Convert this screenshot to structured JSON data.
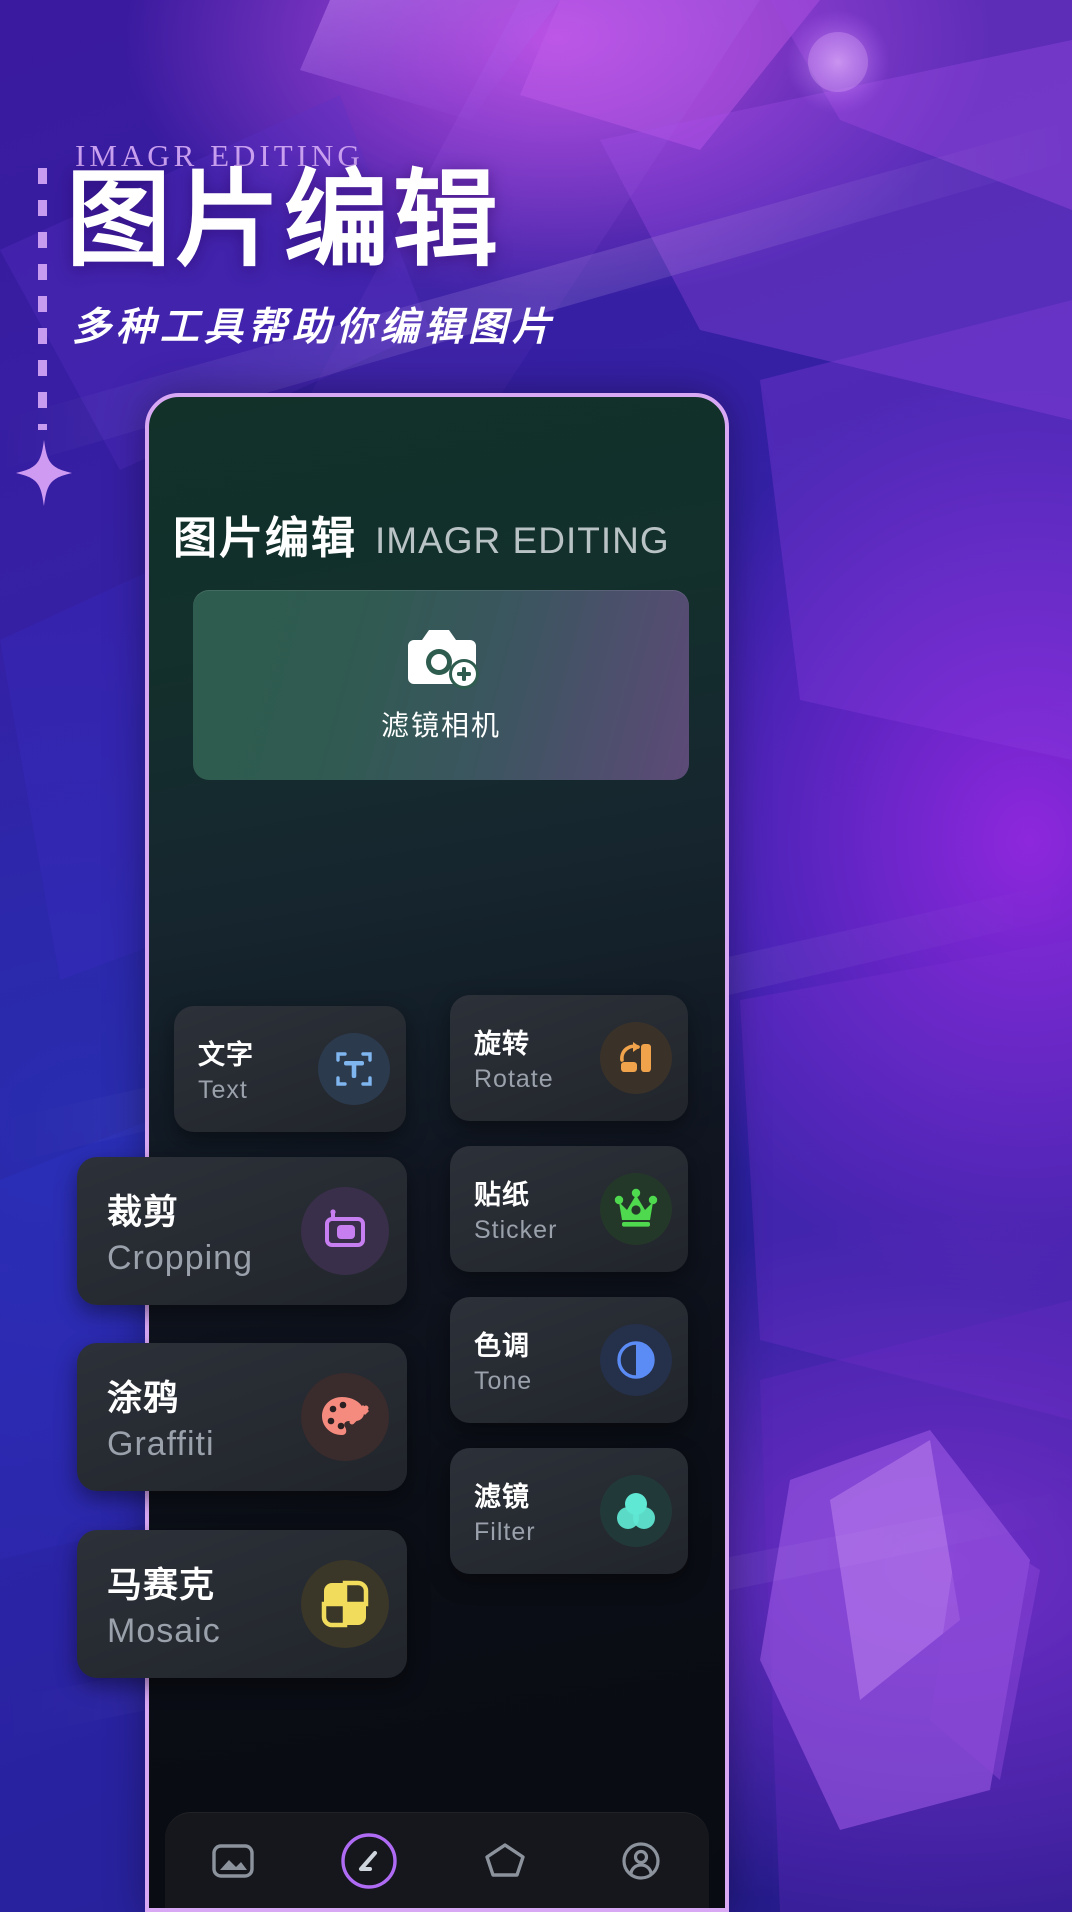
{
  "poster": {
    "eyebrow": "IMAGR EDITING",
    "title": "图片编辑",
    "subtitle": "多种工具帮助你编辑图片",
    "accent_purple": "#c9a0ef",
    "bg_violet": "#3520a4"
  },
  "phone": {
    "app_header": {
      "title_cn": "图片编辑",
      "title_en": "IMAGR EDITING"
    },
    "camera_card": {
      "label": "滤镜相机",
      "icon": "camera-plus-icon"
    },
    "nav": {
      "items": [
        {
          "icon": "gallery-icon"
        },
        {
          "icon": "edit-circle-icon"
        },
        {
          "icon": "shapes-icon"
        },
        {
          "icon": "profile-icon"
        }
      ]
    }
  },
  "tools": [
    {
      "cn": "文字",
      "en": "Text",
      "icon": "text-frame-icon",
      "icon_color": "#7fb6f0",
      "icon_bg": "#2c3a4e"
    },
    {
      "cn": "旋转",
      "en": "Rotate",
      "icon": "rotate-icon",
      "icon_color": "#f0a34a",
      "icon_bg": "#3a3229"
    },
    {
      "cn": "裁剪",
      "en": "Cropping",
      "icon": "crop-icon",
      "icon_color": "#c77ef0",
      "icon_bg": "#3a2f4a"
    },
    {
      "cn": "贴纸",
      "en": "Sticker",
      "icon": "crown-icon",
      "icon_color": "#4ed94e",
      "icon_bg": "#24382a"
    },
    {
      "cn": "涂鸦",
      "en": "Graffiti",
      "icon": "palette-icon",
      "icon_color": "#f58a7e",
      "icon_bg": "#3a2b2c"
    },
    {
      "cn": "色调",
      "en": "Tone",
      "icon": "contrast-icon",
      "icon_color": "#5b8cf5",
      "icon_bg": "#25304a"
    },
    {
      "cn": "马赛克",
      "en": "Mosaic",
      "icon": "mosaic-icon",
      "icon_color": "#f2dc5c",
      "icon_bg": "#3a3628"
    },
    {
      "cn": "滤镜",
      "en": "Filter",
      "icon": "filter-circles-icon",
      "icon_color": "#5fe8d4",
      "icon_bg": "#22393a"
    }
  ]
}
